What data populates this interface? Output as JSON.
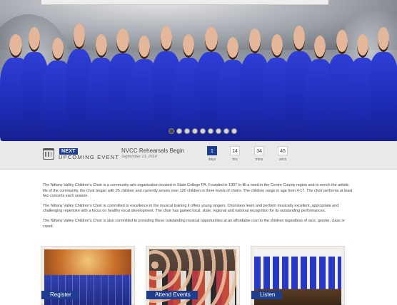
{
  "hero": {
    "slides_count": 9,
    "active_slide": 1
  },
  "event": {
    "badge": "NEXT",
    "label": "UPCOMING EVENT",
    "title": "NVCC Rehearsals Begin",
    "date": "September 13, 2014",
    "countdown": [
      {
        "value": "1",
        "unit": "days"
      },
      {
        "value": "14",
        "unit": "hrs"
      },
      {
        "value": "34",
        "unit": "mins"
      },
      {
        "value": "45",
        "unit": "secs"
      }
    ]
  },
  "about": {
    "paragraphs": [
      "The Nittany Valley Children's Choir is a community arts organization located in State College PA. Founded in 1997 to fill a need in the Centre County region and to enrich the artistic life of the community, the choir began with 25 children and currently serves over 120 children in three levels of choirs. The children range in age from 4-17. The choir performs at least two concerts each season.",
      "The Nittany Valley Children's Choir is committed to excellence in the musical training it offers young singers. Choristers learn and perform musically excellent, appropriate and challenging repertoire with a focus on healthy vocal development. The choir has gained local, state, regional and national recognition for its outstanding performances.",
      "The Nittany Valley Children's Choir is also committed to providing these outstanding musical opportunities at an affordable cost to the children regardless of race, gender, class or creed."
    ]
  },
  "cards": [
    {
      "label": "Register"
    },
    {
      "label": "Attend Events"
    },
    {
      "label": "Listen"
    }
  ],
  "colors": {
    "accent": "#1f3d8f",
    "dress_blue": "#2233c4"
  }
}
